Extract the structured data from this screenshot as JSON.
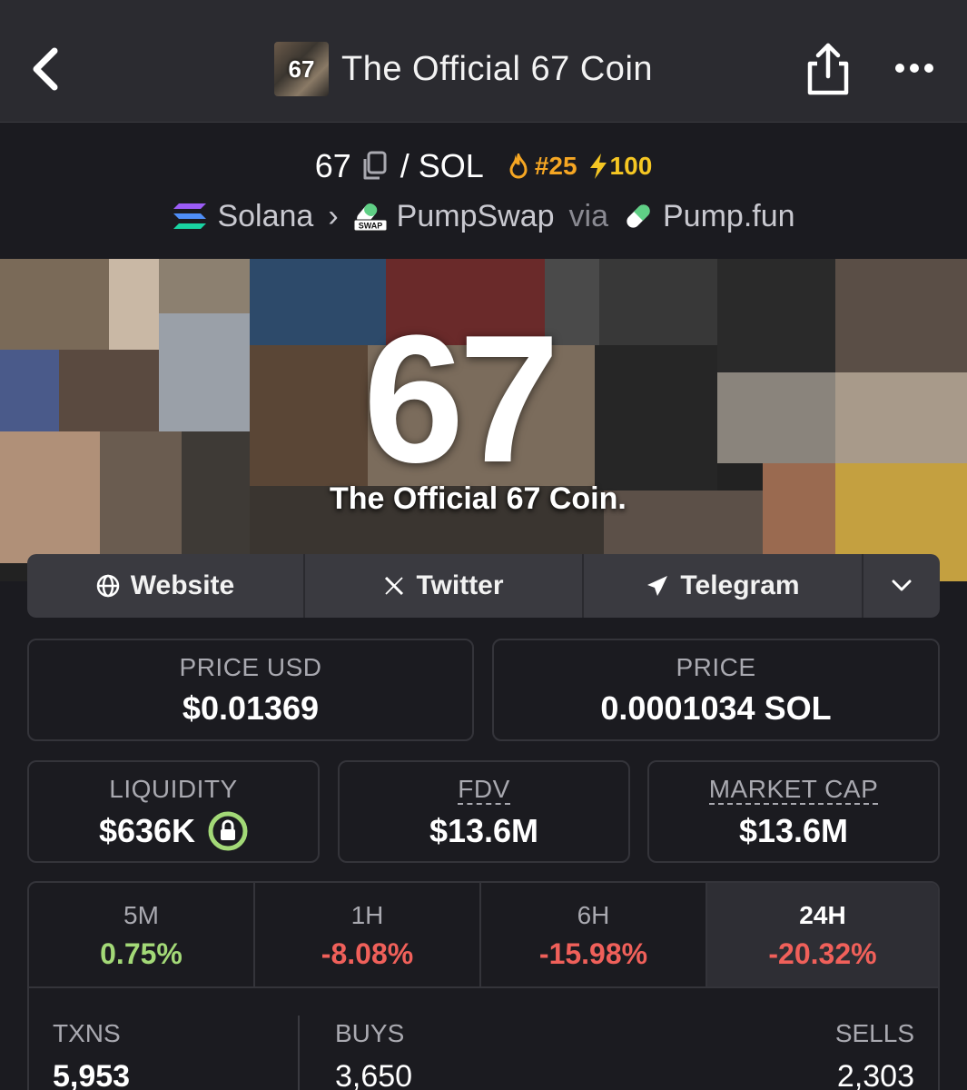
{
  "header": {
    "thumb_text": "67",
    "title": "The Official 67 Coin"
  },
  "pair": {
    "base": "67",
    "quote": "/ SOL",
    "rank": "#25",
    "boost": "100"
  },
  "chain": {
    "network": "Solana",
    "dex": "PumpSwap",
    "dex_badge": "SWAP",
    "via": "via",
    "launchpad": "Pump.fun"
  },
  "banner": {
    "big_text": "67",
    "subtitle": "The Official 67 Coin."
  },
  "links": {
    "website": "Website",
    "twitter": "Twitter",
    "telegram": "Telegram"
  },
  "stats": {
    "price_usd_label": "PRICE USD",
    "price_usd": "$0.01369",
    "price_label": "PRICE",
    "price": "0.0001034 SOL",
    "liquidity_label": "LIQUIDITY",
    "liquidity": "$636K",
    "fdv_label": "FDV",
    "fdv": "$13.6M",
    "mcap_label": "MARKET CAP",
    "mcap": "$13.6M"
  },
  "changes": [
    {
      "period": "5M",
      "pct": "0.75%",
      "color": "#a3d977"
    },
    {
      "period": "1H",
      "pct": "-8.08%",
      "color": "#f0605a"
    },
    {
      "period": "6H",
      "pct": "-15.98%",
      "color": "#f0605a"
    },
    {
      "period": "24H",
      "pct": "-20.32%",
      "color": "#f0605a"
    }
  ],
  "txns": {
    "txns_label": "TXNS",
    "txns": "5,953",
    "buys_label": "BUYS",
    "buys": "3,650",
    "sells_label": "SELLS",
    "sells": "2,303"
  },
  "colors": {
    "background": "#1b1b20",
    "header": "#2b2b30",
    "positive": "#a3d977",
    "negative": "#f0605a",
    "rank": "#f5a623"
  }
}
